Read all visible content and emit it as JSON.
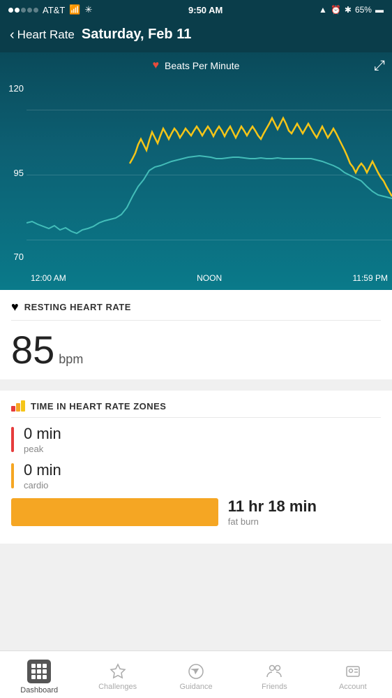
{
  "statusBar": {
    "carrier": "AT&T",
    "time": "9:50 AM",
    "battery": "65%"
  },
  "header": {
    "backLabel": "Heart Rate",
    "title": "Saturday, Feb 11"
  },
  "chart": {
    "legend": "Beats Per Minute",
    "yLabels": [
      "120",
      "95",
      "70"
    ],
    "xLabels": [
      "12:00 AM",
      "NOON",
      "11:59 PM"
    ],
    "expandIcon": "⤢"
  },
  "restingHeartRate": {
    "sectionTitle": "RESTING HEART RATE",
    "value": "85",
    "unit": "bpm"
  },
  "heartRateZones": {
    "sectionTitle": "TIME IN HEART RATE ZONES",
    "zones": [
      {
        "name": "peak",
        "value": "0 min",
        "color": "#e63c3c"
      },
      {
        "name": "cardio",
        "value": "0 min",
        "color": "#f5a623"
      },
      {
        "name": "fat burn",
        "value": "11 hr 18 min",
        "color": "#f5a623",
        "barWidth": "56%"
      }
    ]
  },
  "tabBar": {
    "items": [
      {
        "label": "Dashboard",
        "active": true
      },
      {
        "label": "Challenges",
        "active": false
      },
      {
        "label": "Guidance",
        "active": false
      },
      {
        "label": "Friends",
        "active": false
      },
      {
        "label": "Account",
        "active": false
      }
    ]
  }
}
